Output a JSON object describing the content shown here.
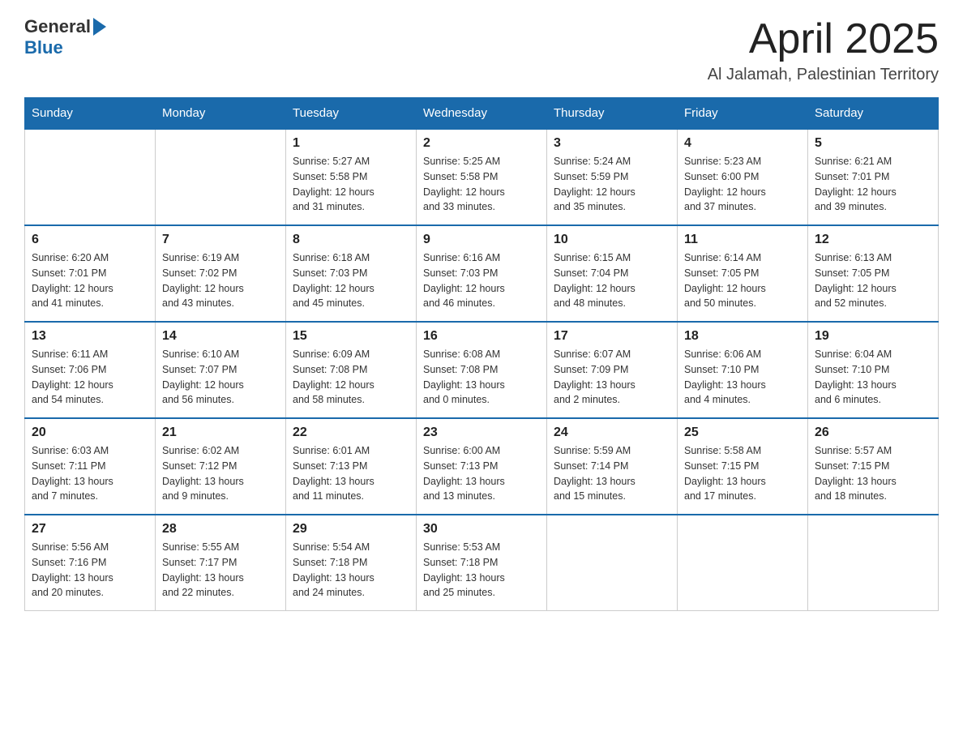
{
  "header": {
    "logo_general": "General",
    "logo_blue": "Blue",
    "month_title": "April 2025",
    "location": "Al Jalamah, Palestinian Territory"
  },
  "weekdays": [
    "Sunday",
    "Monday",
    "Tuesday",
    "Wednesday",
    "Thursday",
    "Friday",
    "Saturday"
  ],
  "weeks": [
    [
      {
        "day": "",
        "info": ""
      },
      {
        "day": "",
        "info": ""
      },
      {
        "day": "1",
        "info": "Sunrise: 5:27 AM\nSunset: 5:58 PM\nDaylight: 12 hours\nand 31 minutes."
      },
      {
        "day": "2",
        "info": "Sunrise: 5:25 AM\nSunset: 5:58 PM\nDaylight: 12 hours\nand 33 minutes."
      },
      {
        "day": "3",
        "info": "Sunrise: 5:24 AM\nSunset: 5:59 PM\nDaylight: 12 hours\nand 35 minutes."
      },
      {
        "day": "4",
        "info": "Sunrise: 5:23 AM\nSunset: 6:00 PM\nDaylight: 12 hours\nand 37 minutes."
      },
      {
        "day": "5",
        "info": "Sunrise: 6:21 AM\nSunset: 7:01 PM\nDaylight: 12 hours\nand 39 minutes."
      }
    ],
    [
      {
        "day": "6",
        "info": "Sunrise: 6:20 AM\nSunset: 7:01 PM\nDaylight: 12 hours\nand 41 minutes."
      },
      {
        "day": "7",
        "info": "Sunrise: 6:19 AM\nSunset: 7:02 PM\nDaylight: 12 hours\nand 43 minutes."
      },
      {
        "day": "8",
        "info": "Sunrise: 6:18 AM\nSunset: 7:03 PM\nDaylight: 12 hours\nand 45 minutes."
      },
      {
        "day": "9",
        "info": "Sunrise: 6:16 AM\nSunset: 7:03 PM\nDaylight: 12 hours\nand 46 minutes."
      },
      {
        "day": "10",
        "info": "Sunrise: 6:15 AM\nSunset: 7:04 PM\nDaylight: 12 hours\nand 48 minutes."
      },
      {
        "day": "11",
        "info": "Sunrise: 6:14 AM\nSunset: 7:05 PM\nDaylight: 12 hours\nand 50 minutes."
      },
      {
        "day": "12",
        "info": "Sunrise: 6:13 AM\nSunset: 7:05 PM\nDaylight: 12 hours\nand 52 minutes."
      }
    ],
    [
      {
        "day": "13",
        "info": "Sunrise: 6:11 AM\nSunset: 7:06 PM\nDaylight: 12 hours\nand 54 minutes."
      },
      {
        "day": "14",
        "info": "Sunrise: 6:10 AM\nSunset: 7:07 PM\nDaylight: 12 hours\nand 56 minutes."
      },
      {
        "day": "15",
        "info": "Sunrise: 6:09 AM\nSunset: 7:08 PM\nDaylight: 12 hours\nand 58 minutes."
      },
      {
        "day": "16",
        "info": "Sunrise: 6:08 AM\nSunset: 7:08 PM\nDaylight: 13 hours\nand 0 minutes."
      },
      {
        "day": "17",
        "info": "Sunrise: 6:07 AM\nSunset: 7:09 PM\nDaylight: 13 hours\nand 2 minutes."
      },
      {
        "day": "18",
        "info": "Sunrise: 6:06 AM\nSunset: 7:10 PM\nDaylight: 13 hours\nand 4 minutes."
      },
      {
        "day": "19",
        "info": "Sunrise: 6:04 AM\nSunset: 7:10 PM\nDaylight: 13 hours\nand 6 minutes."
      }
    ],
    [
      {
        "day": "20",
        "info": "Sunrise: 6:03 AM\nSunset: 7:11 PM\nDaylight: 13 hours\nand 7 minutes."
      },
      {
        "day": "21",
        "info": "Sunrise: 6:02 AM\nSunset: 7:12 PM\nDaylight: 13 hours\nand 9 minutes."
      },
      {
        "day": "22",
        "info": "Sunrise: 6:01 AM\nSunset: 7:13 PM\nDaylight: 13 hours\nand 11 minutes."
      },
      {
        "day": "23",
        "info": "Sunrise: 6:00 AM\nSunset: 7:13 PM\nDaylight: 13 hours\nand 13 minutes."
      },
      {
        "day": "24",
        "info": "Sunrise: 5:59 AM\nSunset: 7:14 PM\nDaylight: 13 hours\nand 15 minutes."
      },
      {
        "day": "25",
        "info": "Sunrise: 5:58 AM\nSunset: 7:15 PM\nDaylight: 13 hours\nand 17 minutes."
      },
      {
        "day": "26",
        "info": "Sunrise: 5:57 AM\nSunset: 7:15 PM\nDaylight: 13 hours\nand 18 minutes."
      }
    ],
    [
      {
        "day": "27",
        "info": "Sunrise: 5:56 AM\nSunset: 7:16 PM\nDaylight: 13 hours\nand 20 minutes."
      },
      {
        "day": "28",
        "info": "Sunrise: 5:55 AM\nSunset: 7:17 PM\nDaylight: 13 hours\nand 22 minutes."
      },
      {
        "day": "29",
        "info": "Sunrise: 5:54 AM\nSunset: 7:18 PM\nDaylight: 13 hours\nand 24 minutes."
      },
      {
        "day": "30",
        "info": "Sunrise: 5:53 AM\nSunset: 7:18 PM\nDaylight: 13 hours\nand 25 minutes."
      },
      {
        "day": "",
        "info": ""
      },
      {
        "day": "",
        "info": ""
      },
      {
        "day": "",
        "info": ""
      }
    ]
  ]
}
